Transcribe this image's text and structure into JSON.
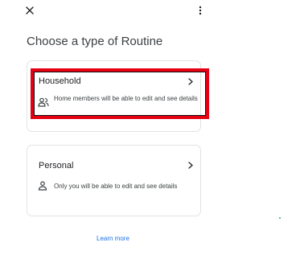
{
  "header": {
    "close_icon": "close-icon",
    "more_icon": "more-vert-icon"
  },
  "page": {
    "title": "Choose a type of Routine"
  },
  "options": {
    "household": {
      "title": "Household",
      "description": "Home members will be able to edit and see details",
      "icon": "people-icon",
      "selected": true,
      "highlight_color": "#e60012"
    },
    "personal": {
      "title": "Personal",
      "description": "Only you will be able to edit and see details",
      "icon": "person-icon"
    }
  },
  "footer": {
    "learn_more": "Learn more",
    "link_color": "#1a73e8"
  },
  "colors": {
    "accent_dot": "#34a853",
    "card_border": "#e3e3e3"
  }
}
